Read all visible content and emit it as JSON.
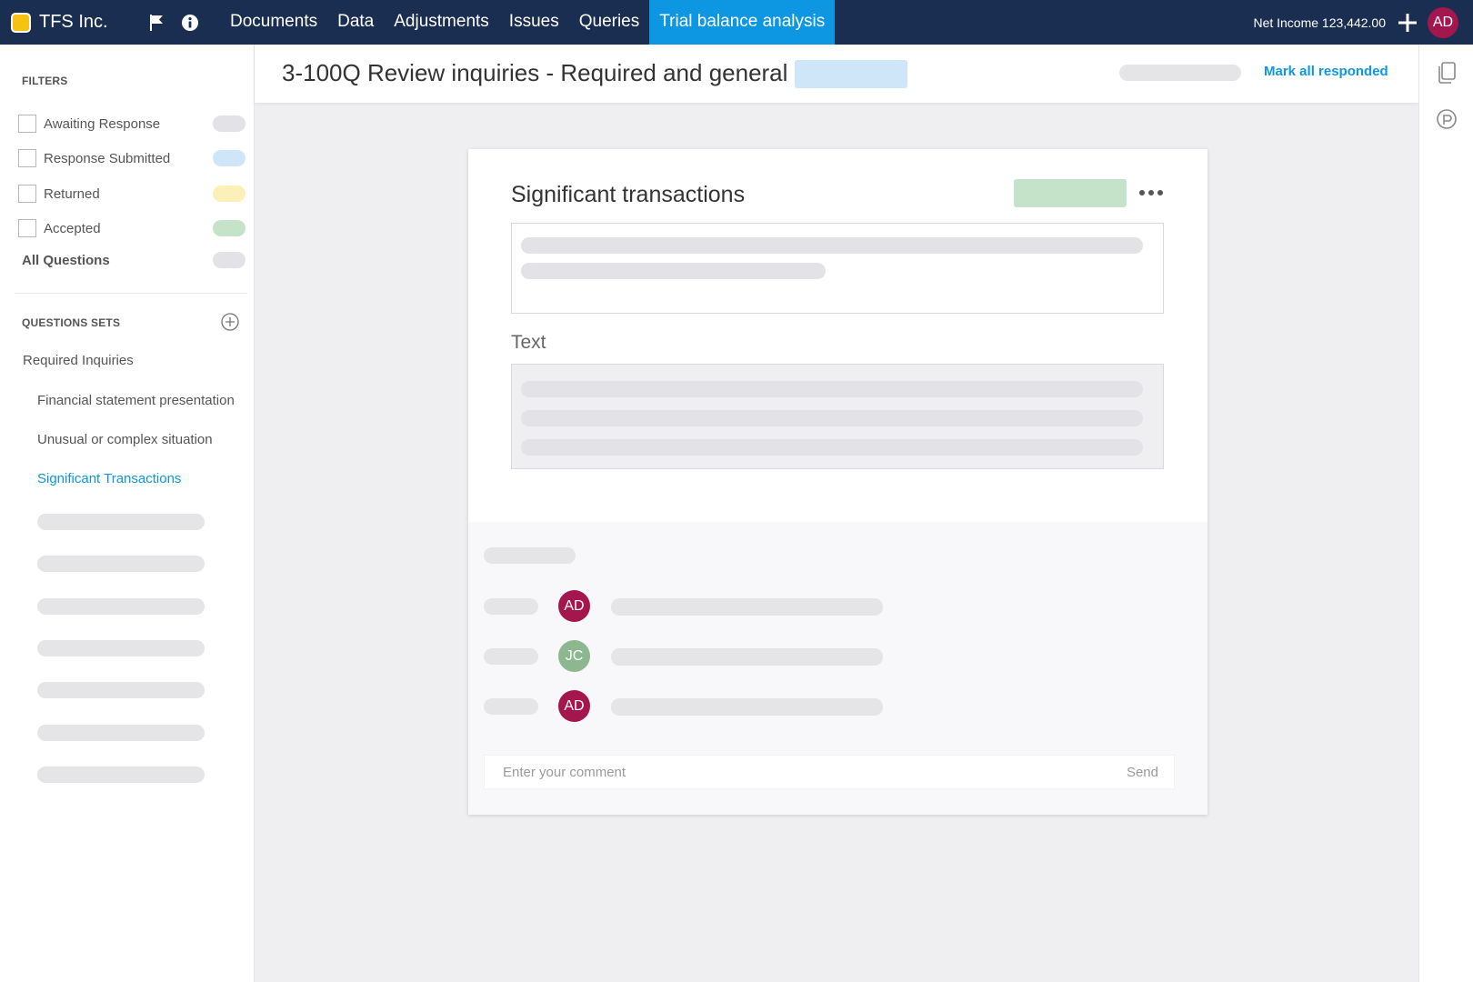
{
  "app": {
    "brand_name": "TFS Inc.",
    "brand_color": "#f5c211",
    "topbar_color": "#1a2e52",
    "accent_color": "#0d97e3"
  },
  "topbar": {
    "icons": [
      "flag-icon",
      "info-icon"
    ],
    "nav": [
      "Documents",
      "Data",
      "Adjustments",
      "Issues",
      "Queries",
      "Trial balance analysis"
    ],
    "active_nav": "Trial balance analysis",
    "net_income": "Net Income 123,442.00",
    "user_initials": "AD"
  },
  "sidebar": {
    "filters_title": "FILTERS",
    "filters": [
      {
        "label": "Awaiting Response",
        "color": "#e3e2e6"
      },
      {
        "label": "Response Submitted",
        "color": "#cfe6f9"
      },
      {
        "label": "Returned",
        "color": "#fcefb8"
      },
      {
        "label": "Accepted",
        "color": "#c4e3c9"
      }
    ],
    "all_questions": "All Questions",
    "sets_title": "QUESTIONS SETS",
    "set_parent": "Required Inquiries",
    "set_children": [
      "Financial statement presentation",
      "Unusual or complex situation",
      "Significant Transactions"
    ],
    "active_child": "Significant Transactions"
  },
  "header": {
    "title": "3-100Q Review inquiries - Required and general",
    "mark_all": "Mark all responded"
  },
  "card": {
    "title": "Significant transactions",
    "text_label": "Text",
    "comments": [
      {
        "initials": "AD",
        "color": "#a3164e"
      },
      {
        "initials": "JC",
        "color": "#8db88f"
      },
      {
        "initials": "AD",
        "color": "#a3164e"
      }
    ],
    "comment_placeholder": "Enter your comment",
    "send_label": "Send"
  },
  "right_rail": {
    "icons": [
      "document-copy-icon",
      "chat-icon"
    ]
  }
}
